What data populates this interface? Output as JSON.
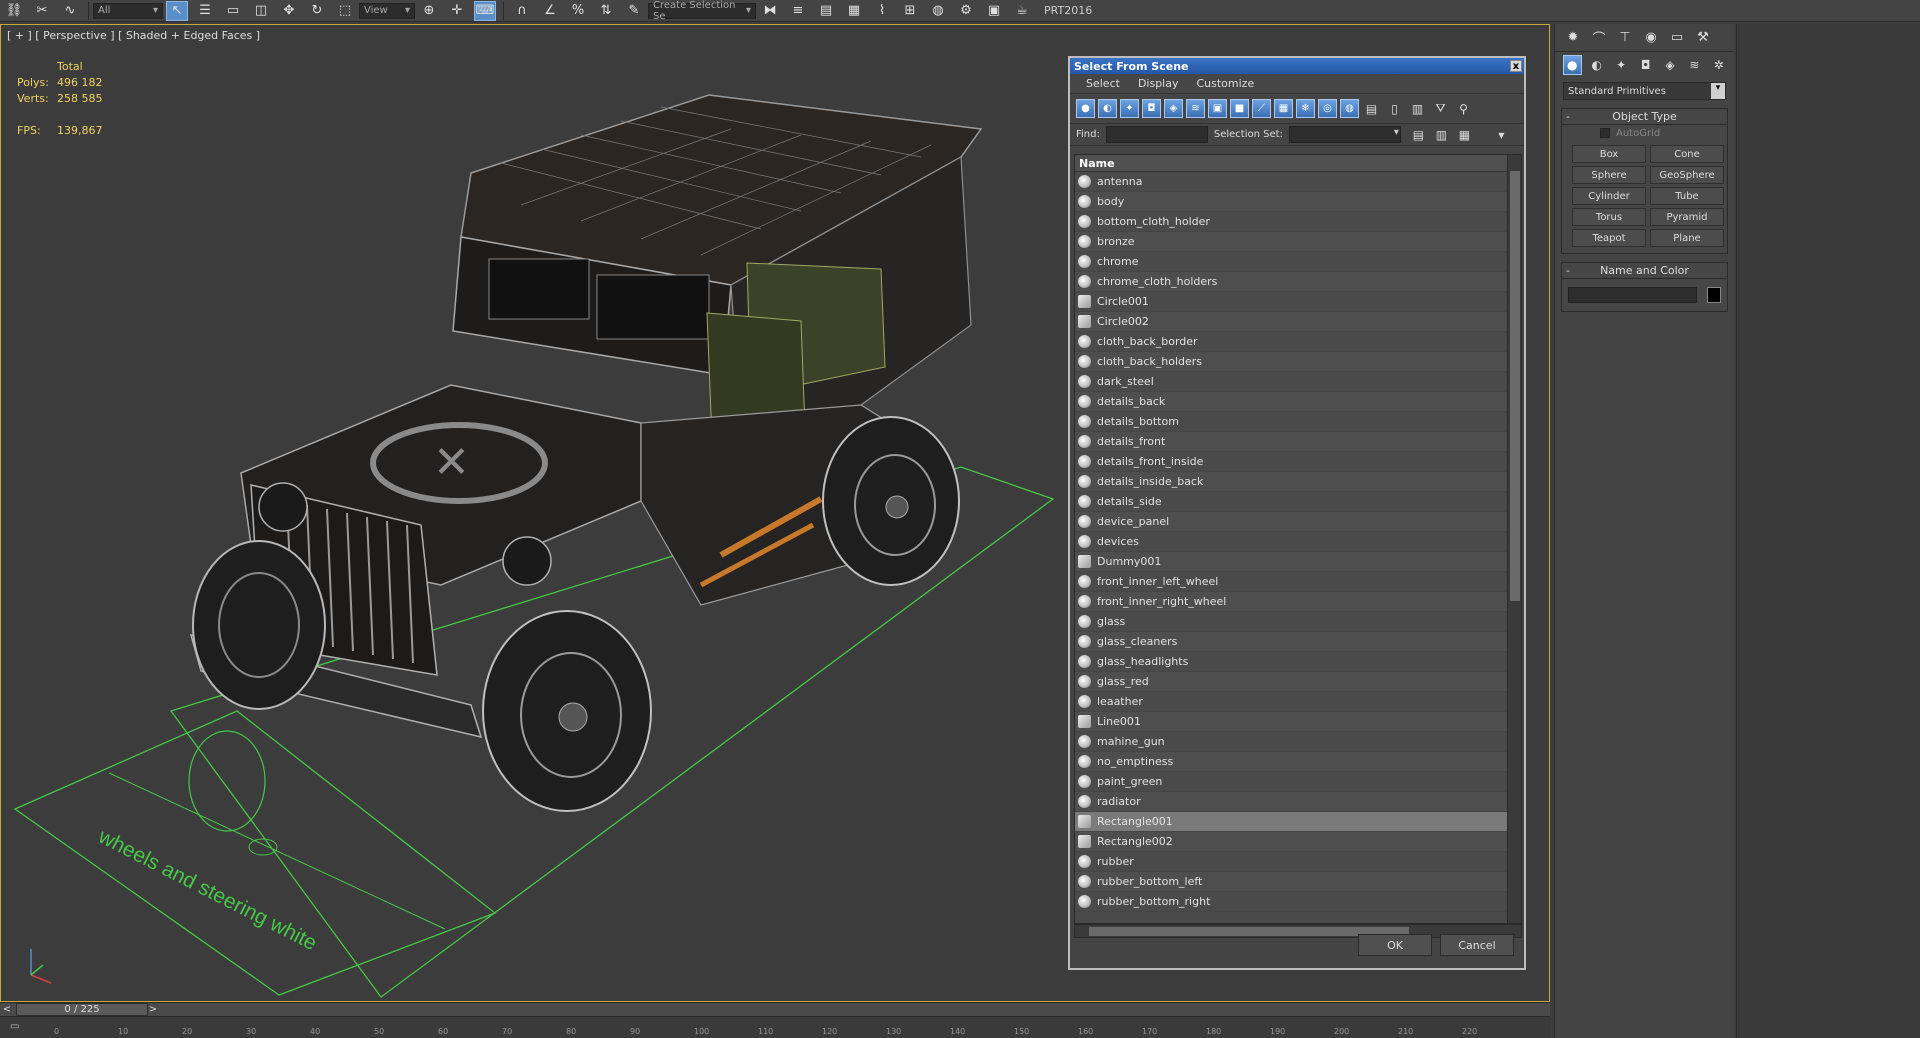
{
  "toolbar": {
    "view_dropdown": "View",
    "selection_set_dropdown": "Create Selection Se",
    "prt_label": "PRT2016"
  },
  "viewport": {
    "label": "[ + ] [ Perspective ] [ Shaded + Edged Faces ]",
    "stats": {
      "total_label": "Total",
      "polys_label": "Polys:",
      "polys_value": "496 182",
      "verts_label": "Verts:",
      "verts_value": "258 585",
      "fps_label": "FPS:",
      "fps_value": "139,867"
    },
    "ground_text": "wheels and steering white"
  },
  "dialog": {
    "title": "Select From Scene",
    "close": "x",
    "menu": [
      "Select",
      "Display",
      "Customize"
    ],
    "find_label": "Find:",
    "selection_set_label": "Selection Set:",
    "list_header": "Name",
    "objects": [
      {
        "name": "antenna",
        "icon": "geometry"
      },
      {
        "name": "body",
        "icon": "geometry"
      },
      {
        "name": "bottom_cloth_holder",
        "icon": "geometry"
      },
      {
        "name": "bronze",
        "icon": "geometry"
      },
      {
        "name": "chrome",
        "icon": "geometry"
      },
      {
        "name": "chrome_cloth_holders",
        "icon": "geometry"
      },
      {
        "name": "Circle001",
        "icon": "shape"
      },
      {
        "name": "Circle002",
        "icon": "shape"
      },
      {
        "name": "cloth_back_border",
        "icon": "geometry"
      },
      {
        "name": "cloth_back_holders",
        "icon": "geometry"
      },
      {
        "name": "dark_steel",
        "icon": "geometry"
      },
      {
        "name": "details_back",
        "icon": "geometry"
      },
      {
        "name": "details_bottom",
        "icon": "geometry"
      },
      {
        "name": "details_front",
        "icon": "geometry"
      },
      {
        "name": "details_front_inside",
        "icon": "geometry"
      },
      {
        "name": "details_inside_back",
        "icon": "geometry"
      },
      {
        "name": "details_side",
        "icon": "geometry"
      },
      {
        "name": "device_panel",
        "icon": "geometry"
      },
      {
        "name": "devices",
        "icon": "geometry"
      },
      {
        "name": "Dummy001",
        "icon": "shape"
      },
      {
        "name": "front_inner_left_wheel",
        "icon": "geometry"
      },
      {
        "name": "front_inner_right_wheel",
        "icon": "geometry"
      },
      {
        "name": "glass",
        "icon": "geometry"
      },
      {
        "name": "glass_cleaners",
        "icon": "geometry"
      },
      {
        "name": "glass_headlights",
        "icon": "geometry"
      },
      {
        "name": "glass_red",
        "icon": "geometry"
      },
      {
        "name": "leaather",
        "icon": "geometry"
      },
      {
        "name": "Line001",
        "icon": "shape"
      },
      {
        "name": "mahine_gun",
        "icon": "geometry"
      },
      {
        "name": "no_emptiness",
        "icon": "geometry"
      },
      {
        "name": "paint_green",
        "icon": "geometry"
      },
      {
        "name": "radiator",
        "icon": "geometry"
      },
      {
        "name": "Rectangle001",
        "icon": "shape",
        "selected": true
      },
      {
        "name": "Rectangle002",
        "icon": "shape"
      },
      {
        "name": "rubber",
        "icon": "geometry"
      },
      {
        "name": "rubber_bottom_left",
        "icon": "geometry"
      },
      {
        "name": "rubber_bottom_right",
        "icon": "geometry"
      }
    ],
    "ok_label": "OK",
    "cancel_label": "Cancel"
  },
  "command_panel": {
    "category_dropdown": "Standard Primitives",
    "object_type_title": "Object Type",
    "autogrid_label": "AutoGrid",
    "primitives": [
      "Box",
      "Cone",
      "Sphere",
      "GeoSphere",
      "Cylinder",
      "Tube",
      "Torus",
      "Pyramid",
      "Teapot",
      "Plane"
    ],
    "name_color_title": "Name and Color",
    "color_swatch": "#000000"
  },
  "timeline": {
    "frame_display": "0 / 225",
    "prev_arrow": "<",
    "next_arrow": ">",
    "ruler_labels": [
      "0",
      "10",
      "20",
      "30",
      "40",
      "50",
      "60",
      "70",
      "80",
      "90",
      "100",
      "110",
      "120",
      "130",
      "140",
      "150",
      "160",
      "170",
      "180",
      "190",
      "200",
      "210",
      "220"
    ]
  },
  "colors": {
    "accent_blue": "#3a74c4",
    "viewport_border": "#c8a83c",
    "stats_yellow": "#f0d060",
    "ground_green": "#46c646"
  }
}
